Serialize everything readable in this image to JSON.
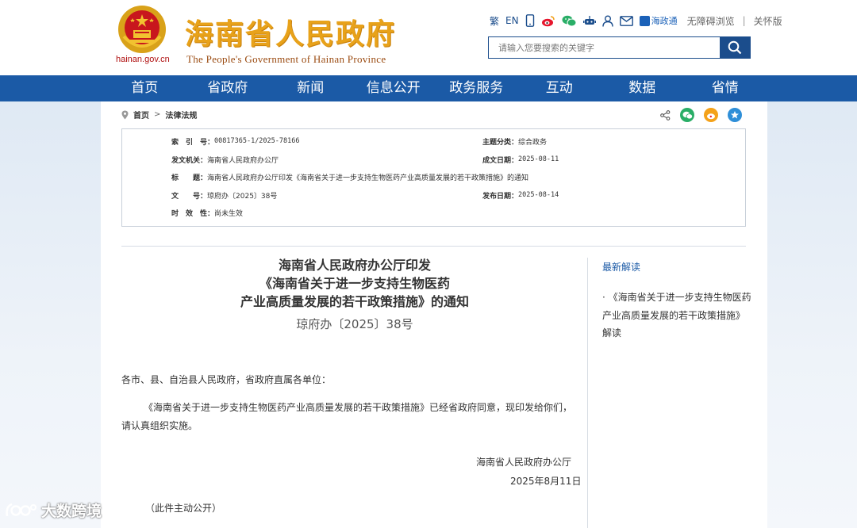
{
  "header": {
    "site_title": "海南省人民政府",
    "site_subtitle": "The People's Government  of Hainan Province",
    "domain": "hainan.gov.cn",
    "tools": {
      "traditional": "繁",
      "english": "EN",
      "zwt": "海政通",
      "accessible": "无障碍浏览",
      "divider": "|",
      "elder": "关怀版"
    },
    "search_placeholder": "请输入您要搜索的关键字"
  },
  "nav": {
    "items": [
      "首页",
      "省政府",
      "新闻",
      "信息公开",
      "政务服务",
      "互动",
      "数据",
      "省情"
    ]
  },
  "breadcrumb": {
    "home": "首页",
    "separator": ">",
    "current": "法律法规"
  },
  "meta": {
    "index_label": "索　引　号：",
    "index_value": "00817365-1/2025-78166",
    "topic_label": "主题分类：",
    "topic_value": "综合政务",
    "issuer_label": "发文机关：",
    "issuer_value": "海南省人民政府办公厅",
    "created_label": "成文日期：",
    "created_value": "2025-08-11",
    "title_label": "标　　题：",
    "title_value": "海南省人民政府办公厅印发《海南省关于进一步支持生物医药产业高质量发展的若干政策措施》的通知",
    "docno_label": "文　　号：",
    "docno_value": "琼府办〔2025〕38号",
    "published_label": "发布日期：",
    "published_value": "2025-08-14",
    "validity_label": "时　效　性：",
    "validity_value": "尚未生效"
  },
  "article": {
    "title_line1": "海南省人民政府办公厅印发",
    "title_line2": "《海南省关于进一步支持生物医药",
    "title_line3": "产业高质量发展的若干政策措施》的通知",
    "doc_no": "琼府办〔2025〕38号",
    "salutation": "各市、县、自治县人民政府，省政府直属各单位：",
    "paragraph": "《海南省关于进一步支持生物医药产业高质量发展的若干政策措施》已经省政府同意，现印发给你们，请认真组织实施。",
    "signature": "海南省人民政府办公厅",
    "date": "2025年8月11日",
    "note": "（此件主动公开）"
  },
  "sidebar": {
    "title": "最新解读",
    "link": "· 《海南省关于进一步支持生物医药产业高质量发展的若干政策措施》解读"
  },
  "watermark": "大数跨境",
  "colors": {
    "nav_blue": "#1b5aa6",
    "title_gold": "#e8a21a",
    "link_blue": "#1b5aa6"
  }
}
